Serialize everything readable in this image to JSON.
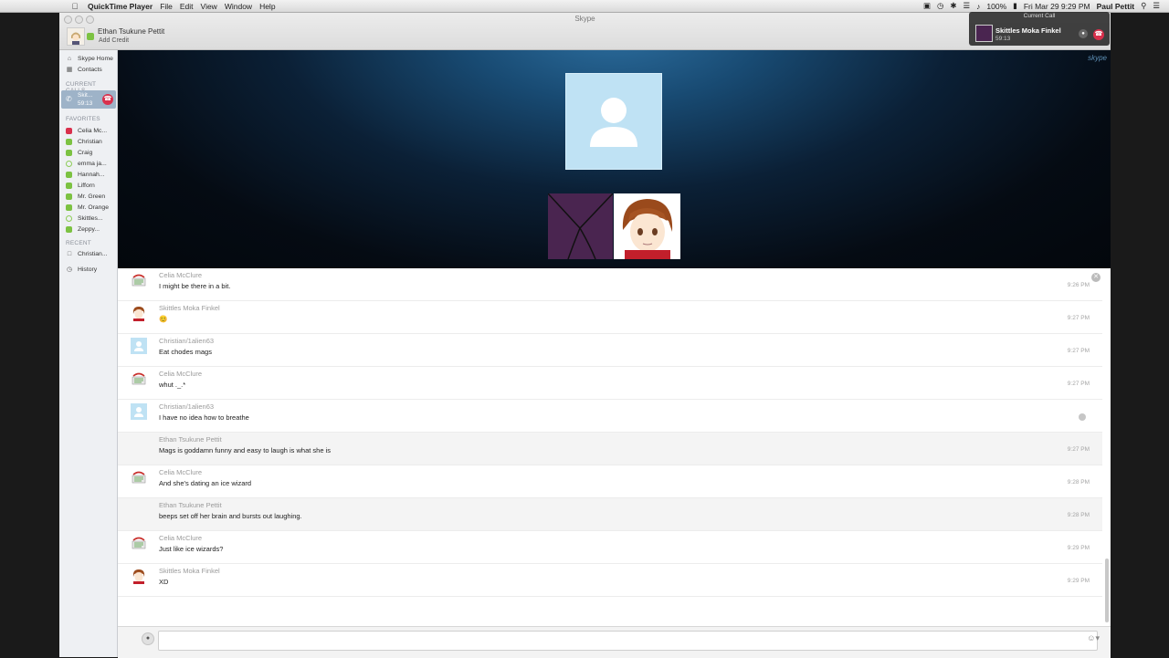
{
  "menubar": {
    "apple_icon": "",
    "app_name": "QuickTime Player",
    "items": [
      "File",
      "Edit",
      "View",
      "Window",
      "Help"
    ],
    "battery": "100%",
    "datetime": "Fri Mar 29  9:29 PM",
    "user": "Paul Pettit"
  },
  "window": {
    "title": "Skype",
    "profile_name": "Ethan Tsukune Pettit",
    "add_credit": "Add Credit",
    "watermark": "skype"
  },
  "sidebar": {
    "home": "Skype Home",
    "contacts": "Contacts",
    "current_calls_heading": "CURRENT CALLS",
    "current_call": {
      "name": "Skit...",
      "time": "59:13"
    },
    "favorites_heading": "FAVORITES",
    "favorites": [
      {
        "name": "Celia Mc...",
        "status": "busy"
      },
      {
        "name": "Christian",
        "status": "online"
      },
      {
        "name": "Craig",
        "status": "online"
      },
      {
        "name": "emma ja...",
        "status": "offline"
      },
      {
        "name": "Hannah...",
        "status": "online"
      },
      {
        "name": "Lifforn",
        "status": "online"
      },
      {
        "name": "Mr. Green",
        "status": "online"
      },
      {
        "name": "Mr. Orange",
        "status": "online"
      },
      {
        "name": "Skittles...",
        "status": "offline"
      },
      {
        "name": "Zeppy...",
        "status": "online"
      }
    ],
    "recent_heading": "RECENT",
    "recent": [
      {
        "name": "Christian..."
      }
    ],
    "history": "History"
  },
  "chat": {
    "messages": [
      {
        "sender": "Celia McClure",
        "text": "I might be there in a bit.",
        "time": "9:26 PM",
        "avatar": "celia"
      },
      {
        "sender": "Skittles Moka Finkel",
        "text": "😊",
        "time": "9:27 PM",
        "avatar": "skittles"
      },
      {
        "sender": "Christian/1alien63",
        "text": "Eat chodes mags",
        "time": "9:27 PM",
        "avatar": "default"
      },
      {
        "sender": "Celia McClure",
        "text": "whut ._.*",
        "time": "9:27 PM",
        "avatar": "celia"
      },
      {
        "sender": "Christian/1alien63",
        "text": "I have no idea how to breathe",
        "time": "",
        "avatar": "default",
        "pending": true
      },
      {
        "sender": "Ethan Tsukune Pettit",
        "text": "Mags is goddamn funny and easy to laugh is what she is",
        "time": "9:27 PM",
        "avatar": "none",
        "shaded": true
      },
      {
        "sender": "Celia McClure",
        "text": "And she's dating an ice wizard",
        "time": "9:28 PM",
        "avatar": "celia"
      },
      {
        "sender": "Ethan Tsukune Pettit",
        "text": "beeps set off her brain and bursts out laughing.",
        "time": "9:28 PM",
        "avatar": "none",
        "shaded": true
      },
      {
        "sender": "Celia McClure",
        "text": "Just like ice wizards?",
        "time": "9:29 PM",
        "avatar": "celia"
      },
      {
        "sender": "Skittles Moka Finkel",
        "text": "XD",
        "time": "9:29 PM",
        "avatar": "skittles"
      }
    ]
  },
  "input": {
    "placeholder": "",
    "emoji": "☺▾"
  },
  "popup": {
    "heading": "Current Call",
    "name": "Skittles Moka Finkel",
    "time": "59:13"
  },
  "colors": {
    "online": "#7cc242",
    "busy": "#d9304c",
    "skype_blue": "#00aff0"
  }
}
